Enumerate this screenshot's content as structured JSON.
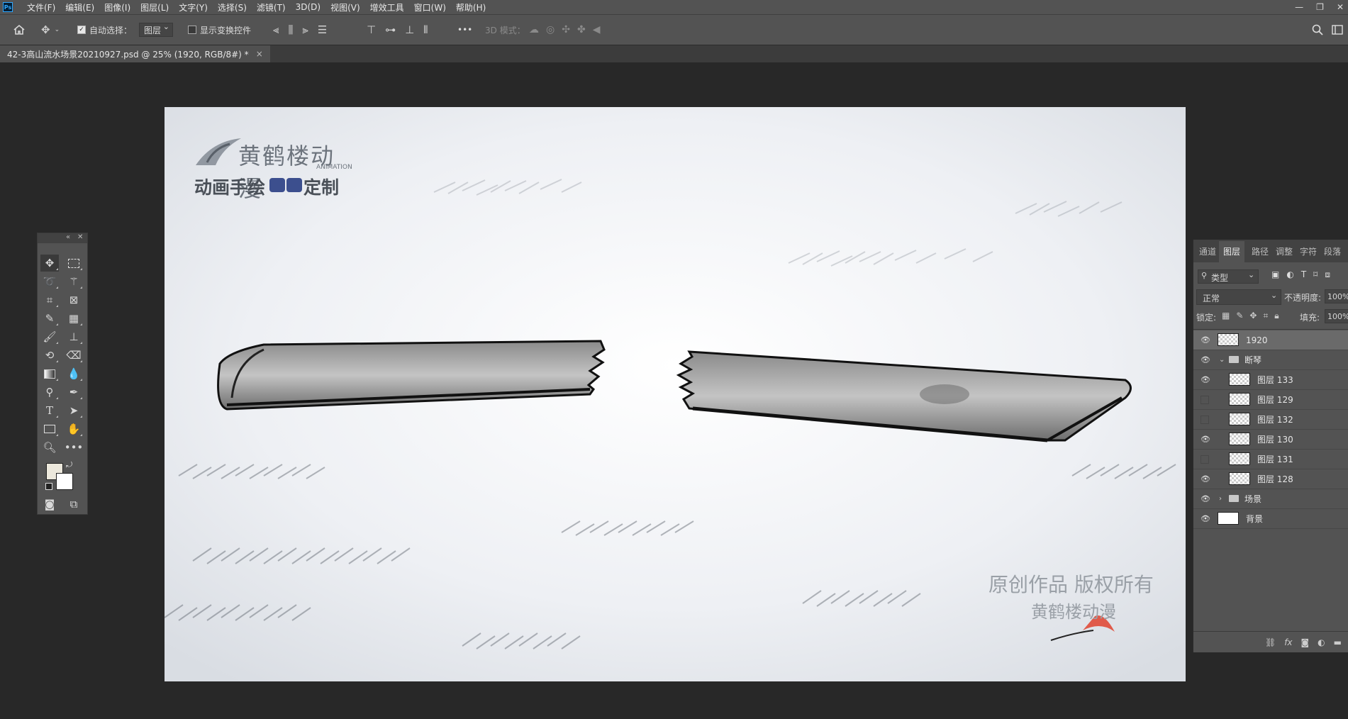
{
  "menu": {
    "logo": "Ps",
    "items": [
      "文件(F)",
      "编辑(E)",
      "图像(I)",
      "图层(L)",
      "文字(Y)",
      "选择(S)",
      "滤镜(T)",
      "3D(D)",
      "视图(V)",
      "增效工具",
      "窗口(W)",
      "帮助(H)"
    ],
    "window_controls": [
      "—",
      "❐",
      "✕"
    ]
  },
  "options": {
    "auto_select_label": "自动选择：",
    "auto_select_target": "图层",
    "show_transform_label": "显示变换控件",
    "mode_3d_label": "3D 模式：",
    "more": "•••"
  },
  "document": {
    "tab_title": "42-3高山流水场景20210927.psd @ 25% (1920, RGB/8#) *",
    "close": "×"
  },
  "canvas": {
    "logo_brand": "黄鹤楼动漫",
    "logo_sub": "ANIMATION",
    "logo_slogan": "动画手绘",
    "logo_slogan_end": "定制",
    "watermark_line1": "原创作品 版权所有",
    "watermark_line2": "黄鹤楼动漫"
  },
  "tools": {
    "collapse": "«",
    "close": "✕"
  },
  "layers_panel": {
    "tabs": [
      "通道",
      "图层",
      "路径",
      "调整",
      "字符",
      "段落"
    ],
    "active_tab": "图层",
    "filter_kind": "类型",
    "blend_mode": "正常",
    "opacity_label": "不透明度:",
    "opacity_value": "100%",
    "lock_label": "锁定:",
    "fill_label": "填充:",
    "fill_value": "100%",
    "layers": [
      {
        "name": "1920",
        "visible": true,
        "type": "smart",
        "selected": true
      },
      {
        "name": "断琴",
        "visible": true,
        "type": "group-open"
      },
      {
        "name": "图层 133",
        "visible": true,
        "type": "layer"
      },
      {
        "name": "图层 129",
        "visible": false,
        "type": "layer"
      },
      {
        "name": "图层 132",
        "visible": false,
        "type": "layer"
      },
      {
        "name": "图层 130",
        "visible": true,
        "type": "layer"
      },
      {
        "name": "图层 131",
        "visible": false,
        "type": "layer"
      },
      {
        "name": "图层 128",
        "visible": true,
        "type": "layer"
      },
      {
        "name": "场景",
        "visible": true,
        "type": "group-closed"
      },
      {
        "name": "背景",
        "visible": true,
        "type": "background"
      }
    ],
    "footer_icons": [
      "link-icon",
      "fx-icon",
      "mask-icon",
      "adjustment-icon",
      "folder-icon"
    ]
  }
}
